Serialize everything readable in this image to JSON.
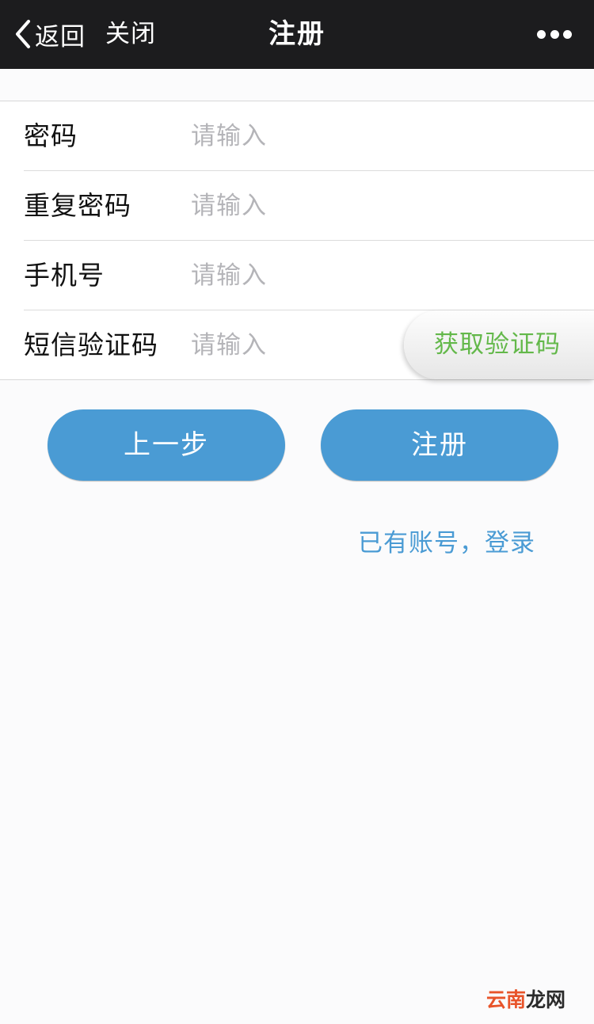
{
  "navbar": {
    "back_label": "返回",
    "close_label": "关闭",
    "title": "注册",
    "more_icon": "more-dots-icon"
  },
  "form": {
    "rows": [
      {
        "label": "密码",
        "placeholder": "请输入",
        "value": ""
      },
      {
        "label": "重复密码",
        "placeholder": "请输入",
        "value": ""
      },
      {
        "label": "手机号",
        "placeholder": "请输入",
        "value": ""
      },
      {
        "label": "短信验证码",
        "placeholder": "请输入",
        "value": ""
      }
    ],
    "get_code_label": "获取验证码"
  },
  "actions": {
    "prev_label": "上一步",
    "register_label": "注册"
  },
  "login_link": "已有账号，登录",
  "watermark": {
    "part1": "云南",
    "part2": "龙网"
  },
  "colors": {
    "navbar_bg": "#1c1c1e",
    "button_blue": "#4a9bd4",
    "code_green": "#63b84a",
    "placeholder_gray": "#b4b4b8"
  }
}
